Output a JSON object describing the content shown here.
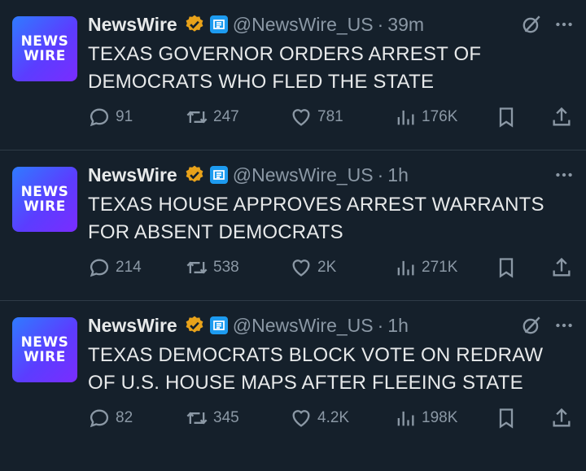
{
  "colors": {
    "background": "#15202b",
    "text": "#e7e9ea",
    "muted": "#8b98a5",
    "verified": "#e8a21a",
    "affiliate": "#1d9bf0"
  },
  "tweets": [
    {
      "avatar_line1": "NEWS",
      "avatar_line2": "WIRE",
      "name": "NewsWire",
      "handle": "@NewsWire_US",
      "separator": "·",
      "time": "39m",
      "show_grok": true,
      "text": "TEXAS GOVERNOR ORDERS ARREST OF DEMOCRATS WHO FLED THE STATE",
      "replies": "91",
      "reposts": "247",
      "likes": "781",
      "views": "176K"
    },
    {
      "avatar_line1": "NEWS",
      "avatar_line2": "WIRE",
      "name": "NewsWire",
      "handle": "@NewsWire_US",
      "separator": "·",
      "time": "1h",
      "show_grok": false,
      "text": "TEXAS HOUSE APPROVES ARREST WARRANTS FOR ABSENT DEMOCRATS",
      "replies": "214",
      "reposts": "538",
      "likes": "2K",
      "views": "271K"
    },
    {
      "avatar_line1": "NEWS",
      "avatar_line2": "WIRE",
      "name": "NewsWire",
      "handle": "@NewsWire_US",
      "separator": "·",
      "time": "1h",
      "show_grok": true,
      "text": "TEXAS DEMOCRATS BLOCK VOTE ON REDRAW OF U.S. HOUSE MAPS AFTER FLEEING STATE",
      "replies": "82",
      "reposts": "345",
      "likes": "4.2K",
      "views": "198K"
    }
  ],
  "icons": {
    "verified": "verified-badge-icon",
    "affiliate": "affiliate-badge-icon",
    "grok": "grok-icon",
    "more": "more-icon",
    "reply": "reply-icon",
    "repost": "repost-icon",
    "like": "heart-icon",
    "views": "views-icon",
    "bookmark": "bookmark-icon",
    "share": "share-icon"
  }
}
